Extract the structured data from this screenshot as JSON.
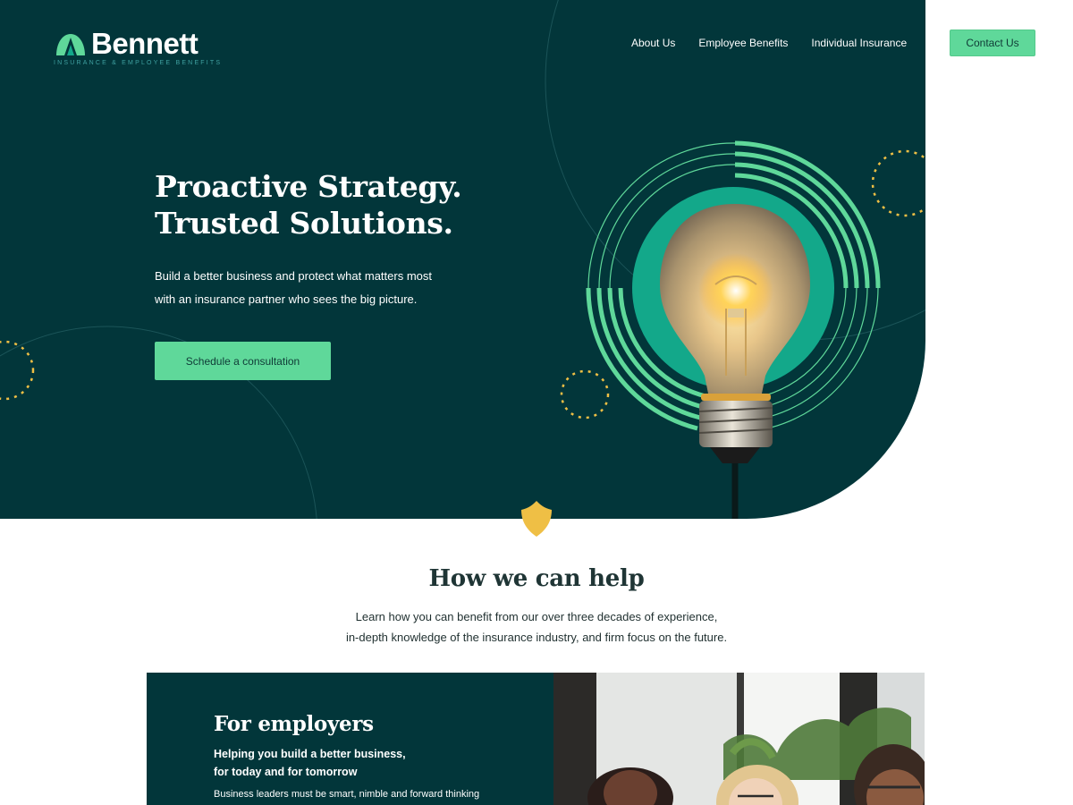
{
  "brand": {
    "name": "Bennett",
    "tagline": "INSURANCE & EMPLOYEE BENEFITS",
    "colors": {
      "dark_teal": "#02363a",
      "accent_green": "#5fd89a",
      "teal": "#13a88a",
      "gold": "#efbf45"
    }
  },
  "nav": {
    "items": [
      {
        "label": "About Us"
      },
      {
        "label": "Employee Benefits"
      },
      {
        "label": "Individual Insurance"
      }
    ],
    "contact_label": "Contact Us"
  },
  "hero": {
    "title_lines": [
      "Proactive Strategy.",
      "Trusted Solutions."
    ],
    "subtitle_lines": [
      "Build a better business and protect what matters most",
      "with an insurance partner who sees the big picture."
    ],
    "cta_label": "Schedule a consultation",
    "image_icon": "light-bulb-icon"
  },
  "help": {
    "title": "How we can help",
    "description_lines": [
      "Learn how you can benefit from our over three decades of experience,",
      "in-depth knowledge of the insurance industry, and firm focus on the future."
    ]
  },
  "employers": {
    "title": "For employers",
    "subtitle_lines": [
      "Helping you build a better business,",
      "for today and for tomorrow"
    ],
    "body": "Business leaders must be smart, nimble and forward thinking"
  },
  "divider_icon": "shield-icon"
}
